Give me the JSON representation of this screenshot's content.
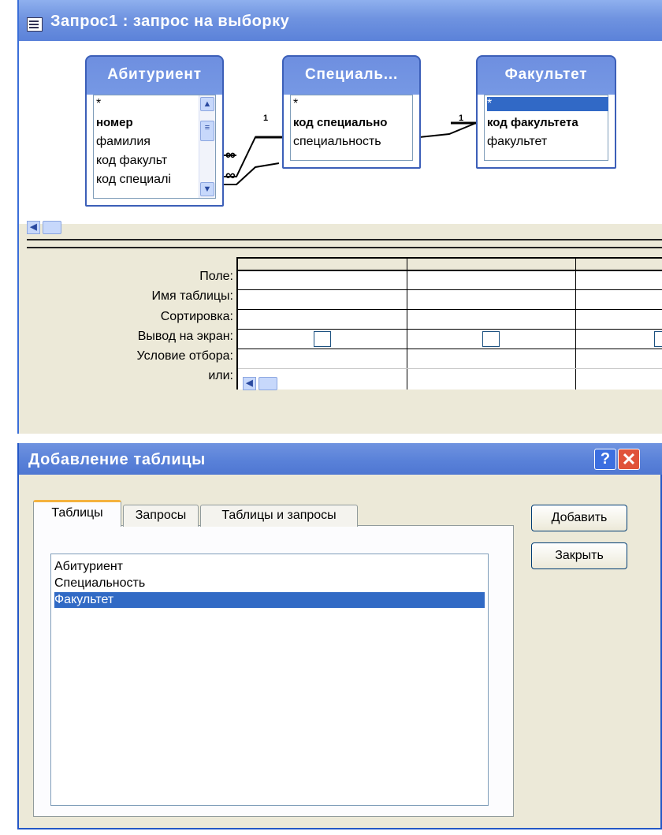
{
  "query_window": {
    "title": "Запрос1 : запрос на выборку",
    "tables": [
      {
        "title": "Абитуриент",
        "fields": [
          "*",
          "номер",
          "фамилия",
          "код факульт",
          "код специалі"
        ],
        "key_field_index": 1
      },
      {
        "title": "Специаль...",
        "fields": [
          "*",
          "код специально",
          "специальность"
        ],
        "key_field_index": 1
      },
      {
        "title": "Факультет",
        "fields": [
          "*",
          "код факультета",
          "факультет"
        ],
        "key_field_index": 1,
        "selected_index": 0
      }
    ],
    "relations": [
      {
        "one_label": "1",
        "many_label": "∞"
      },
      {
        "one_label": "1",
        "many_label": "∞"
      }
    ],
    "grid": {
      "row_labels": [
        "Поле:",
        "Имя таблицы:",
        "Сортировка:",
        "Вывод на экран:",
        "Условие отбора:",
        "или:"
      ],
      "columns": 3
    }
  },
  "add_table_dialog": {
    "title": "Добавление таблицы",
    "help_label": "?",
    "close_label": "✕",
    "tabs": [
      "Таблицы",
      "Запросы",
      "Таблицы и запросы"
    ],
    "active_tab": 0,
    "items": [
      "Абитуриент",
      "Специальность",
      "Факультет"
    ],
    "selected_item": 2,
    "buttons": {
      "add": "Добавить",
      "close": "Закрыть"
    }
  },
  "colors": {
    "title_bar": "#6f93e0",
    "selection": "#316ac5",
    "window_bg": "#ece9d8"
  }
}
